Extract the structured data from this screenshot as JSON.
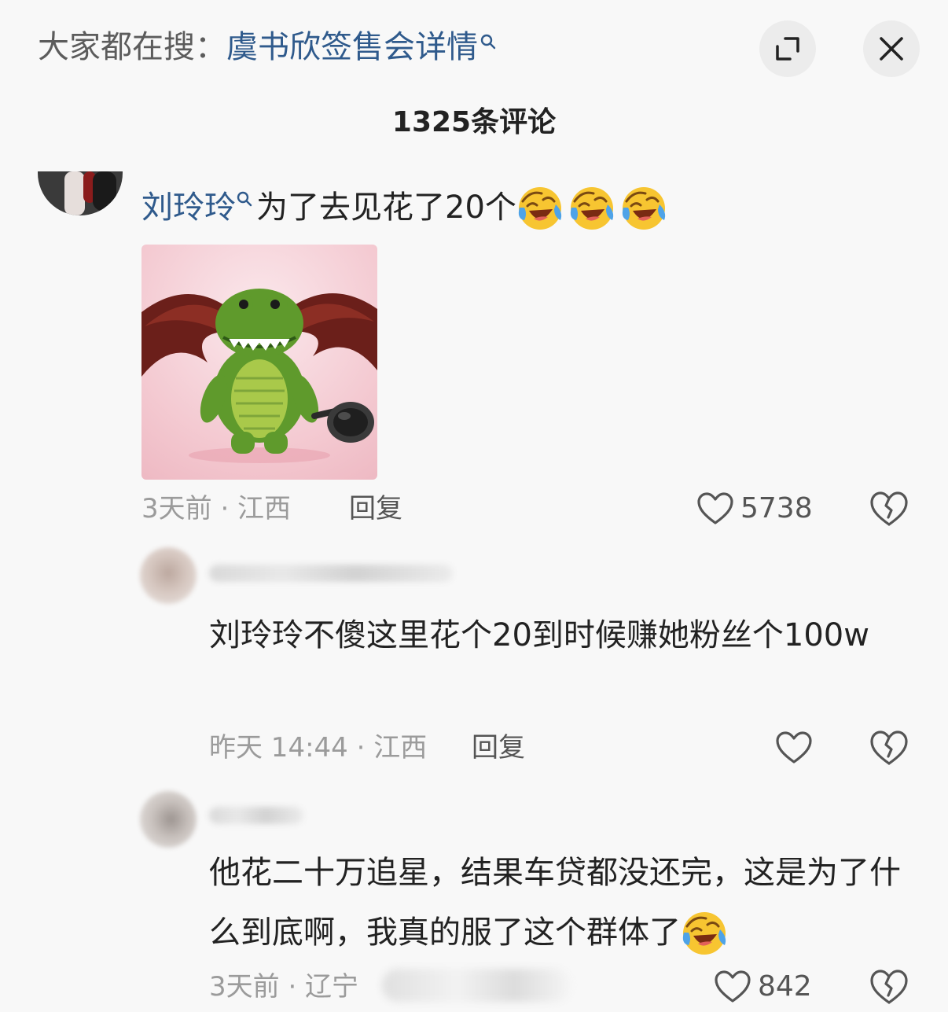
{
  "header": {
    "search_prefix": "大家都在搜：",
    "search_topic": "虞书欣签售会详情",
    "expand_icon": "expand-icon",
    "close_icon": "close-icon"
  },
  "comment_count": "1325条评论",
  "main_comment": {
    "username": "刘玲玲",
    "text": "为了去见花了20个",
    "emoji": "rolling-laugh-emoji",
    "time": "3天前 · 江西",
    "reply_label": "回复",
    "likes": "5738"
  },
  "replies": [
    {
      "text": "刘玲玲不傻这里花个20到时候赚她粉丝个100w",
      "time": "昨天 14:44 · 江西",
      "reply_label": "回复",
      "likes": ""
    },
    {
      "text": "他花二十万追星，结果车贷都没还完，这是为了什么到底啊，我真的服了这个群体了",
      "emoji": "rolling-laugh-emoji",
      "time": "3天前 · 辽宁",
      "likes": "842"
    }
  ],
  "colors": {
    "link_blue": "#2f5a8c",
    "text": "#222222",
    "meta_gray": "#9b9b9b",
    "background": "#f8f8f8"
  }
}
